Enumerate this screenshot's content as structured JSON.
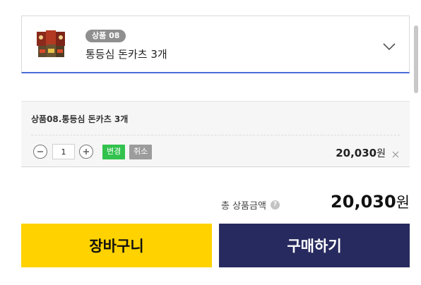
{
  "selector": {
    "badge": "상품 08",
    "name": "통등심 돈카츠 3개"
  },
  "option": {
    "title": "상품08.통등심 돈카츠 3개",
    "quantity": "1",
    "change_label": "변경",
    "cancel_label": "취소",
    "price": "20,030",
    "currency": "원"
  },
  "summary": {
    "total_label": "총 상품금액",
    "help_icon": "?",
    "total_price": "20,030",
    "currency": "원"
  },
  "actions": {
    "cart_label": "장바구니",
    "buy_label": "구매하기"
  },
  "colors": {
    "cart_button": "#ffd200",
    "buy_button": "#272a5e",
    "change_button": "#33c24e",
    "cancel_button": "#9c9c9c",
    "selector_underline": "#4a6bd8"
  }
}
